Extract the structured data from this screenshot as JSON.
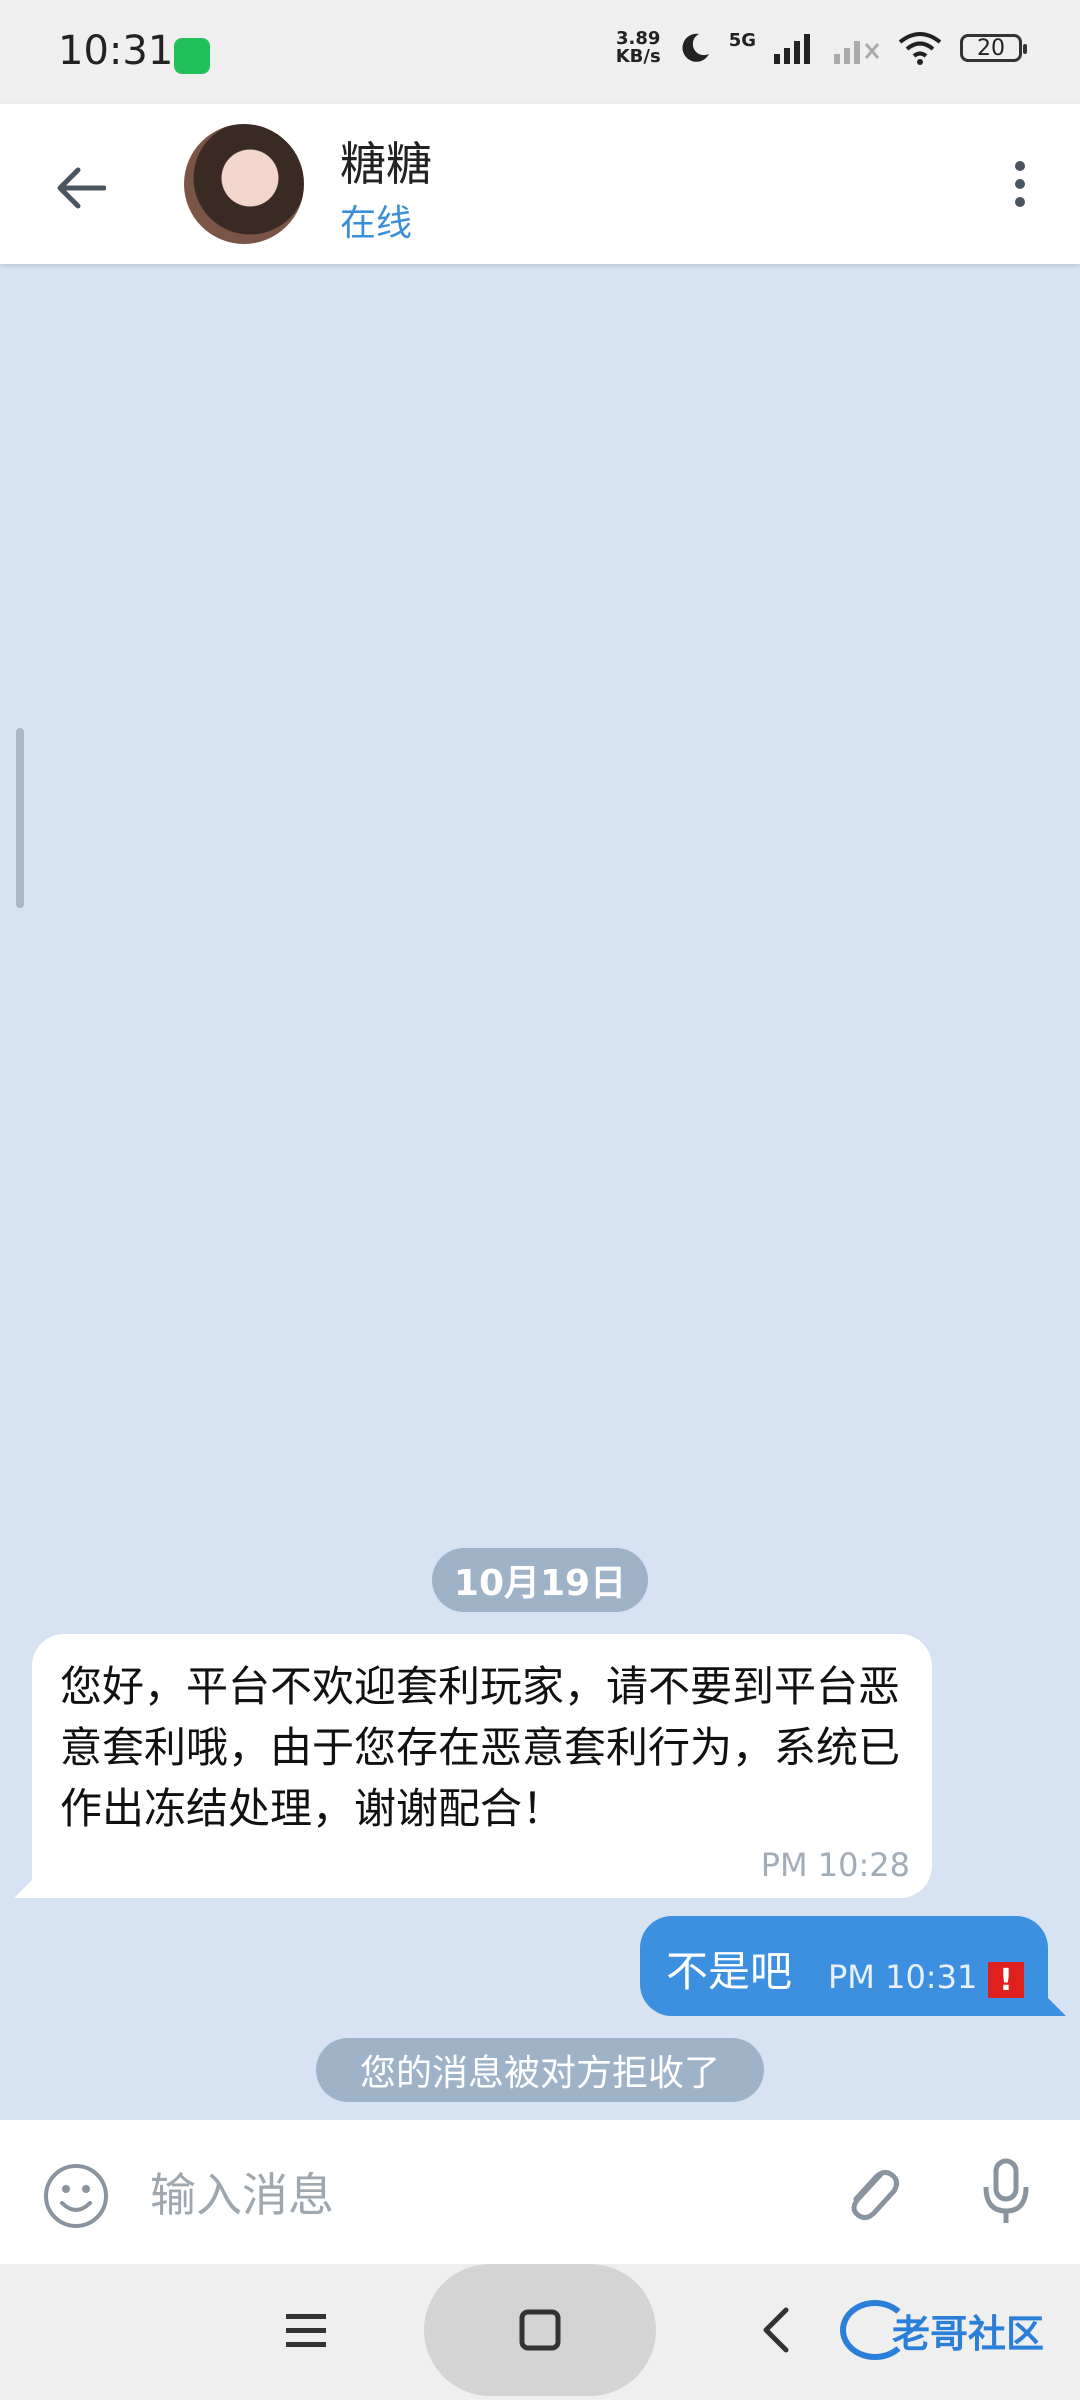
{
  "status_bar": {
    "time": "10:31",
    "net_speed_value": "3.89",
    "net_speed_unit": "KB/s",
    "network": "5G",
    "battery": "20"
  },
  "header": {
    "contact_name": "糖糖",
    "contact_status": "在线"
  },
  "chat": {
    "date_separator": "10月19日",
    "messages": [
      {
        "direction": "incoming",
        "text": "您好，平台不欢迎套利玩家，请不要到平台恶意套利哦，由于您存在恶意套利行为，系统已作出冻结处理，谢谢配合！",
        "time": "PM 10:28"
      },
      {
        "direction": "outgoing",
        "text": "不是吧",
        "time": "PM 10:31",
        "status_icon": "error-icon",
        "status_symbol": "!"
      }
    ],
    "system_notice": "您的消息被对方拒收了"
  },
  "input": {
    "placeholder": "输入消息"
  },
  "watermark": {
    "text": "老哥社区"
  },
  "colors": {
    "chat_background": "#d7e3f2",
    "outgoing_bubble": "#3d8fe0",
    "incoming_bubble": "#ffffff",
    "status_online": "#3a8fd8",
    "error": "#e0201c"
  }
}
